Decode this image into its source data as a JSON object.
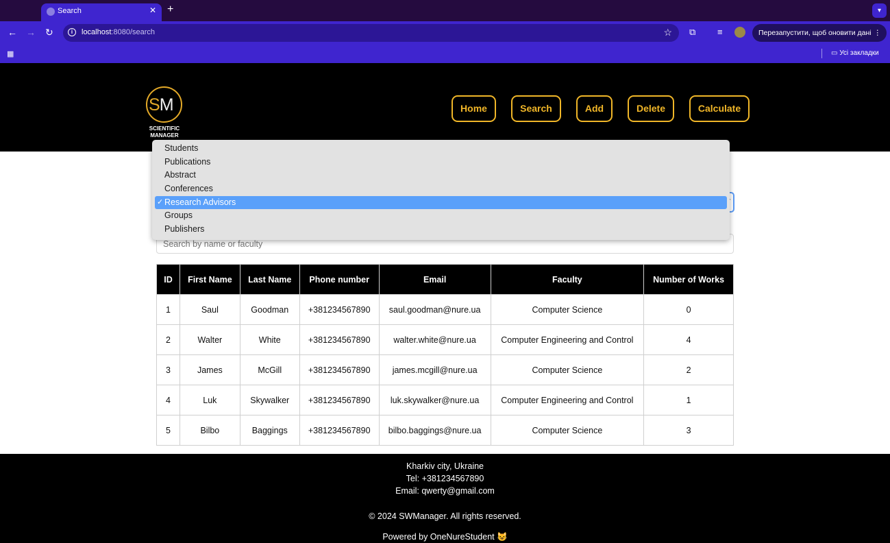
{
  "browser": {
    "tab_title": "Search",
    "new_tab": "+",
    "tab_close": "✕",
    "url_host": "localhost",
    "url_path": ":8080/search",
    "restart_text": "Перезапустити, щоб оновити дані",
    "bookmarks_folder": "Усі закладки"
  },
  "header": {
    "logo_letters_s": "S",
    "logo_letters_m": "M",
    "logo_line1": "SCIENTIFIC",
    "logo_line2": "MANAGER",
    "nav": [
      {
        "label": "Home"
      },
      {
        "label": "Search"
      },
      {
        "label": "Add"
      },
      {
        "label": "Delete"
      },
      {
        "label": "Calculate"
      }
    ]
  },
  "dropdown": {
    "options": [
      "Students",
      "Publications",
      "Abstract",
      "Conferences",
      "Research Advisors",
      "Groups",
      "Publishers"
    ],
    "selected": "Research Advisors",
    "check": "✓"
  },
  "search": {
    "placeholder": "Search by name or faculty"
  },
  "table": {
    "headers": [
      "ID",
      "First Name",
      "Last Name",
      "Phone number",
      "Email",
      "Faculty",
      "Number of Works"
    ],
    "rows": [
      [
        "1",
        "Saul",
        "Goodman",
        "+381234567890",
        "saul.goodman@nure.ua",
        "Computer Science",
        "0"
      ],
      [
        "2",
        "Walter",
        "White",
        "+381234567890",
        "walter.white@nure.ua",
        "Computer Engineering and Control",
        "4"
      ],
      [
        "3",
        "James",
        "McGill",
        "+381234567890",
        "james.mcgill@nure.ua",
        "Computer Science",
        "2"
      ],
      [
        "4",
        "Luk",
        "Skywalker",
        "+381234567890",
        "luk.skywalker@nure.ua",
        "Computer Engineering and Control",
        "1"
      ],
      [
        "5",
        "Bilbo",
        "Baggings",
        "+381234567890",
        "bilbo.baggings@nure.ua",
        "Computer Science",
        "3"
      ]
    ]
  },
  "footer": {
    "city": "Kharkiv city, Ukraine",
    "tel": "Tel: +381234567890",
    "email": "Email: qwerty@gmail.com",
    "copyright": "© 2024 SWManager. All rights reserved.",
    "powered": "Powered by OneNureStudent 😺"
  },
  "colors": {
    "accent": "#f0b628",
    "browser_frame": "#3f25cf",
    "selected_option": "#5aa0fa"
  }
}
